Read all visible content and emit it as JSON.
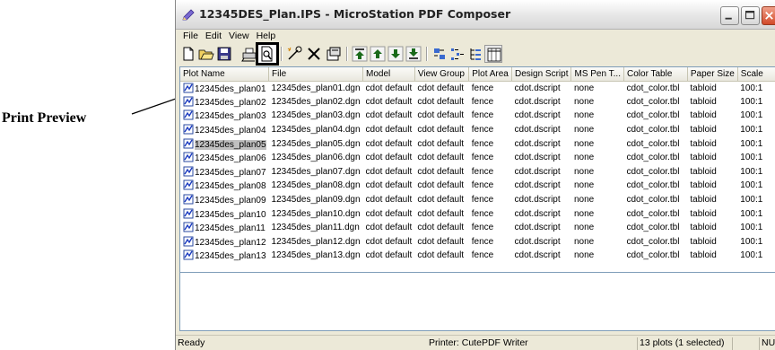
{
  "annotation": {
    "label": "Print Preview"
  },
  "window": {
    "title": "12345DES_Plan.IPS - MicroStation PDF Composer"
  },
  "menu": [
    "File",
    "Edit",
    "View",
    "Help"
  ],
  "toolbar": [
    {
      "icon": "new-document-icon"
    },
    {
      "icon": "open-folder-icon"
    },
    {
      "icon": "save-icon"
    },
    {
      "icon": "print-icon"
    },
    {
      "icon": "print-preview-icon"
    },
    {
      "icon": "add-plots-icon"
    },
    {
      "icon": "delete-icon"
    },
    {
      "icon": "properties-icon"
    },
    {
      "icon": "move-top-icon"
    },
    {
      "icon": "move-up-icon"
    },
    {
      "icon": "move-down-icon"
    },
    {
      "icon": "move-bottom-icon"
    },
    {
      "icon": "large-icons-view-icon"
    },
    {
      "icon": "list-view-icon"
    },
    {
      "icon": "tree-view-icon"
    },
    {
      "icon": "details-view-icon"
    }
  ],
  "table": {
    "columns": [
      "Plot Name",
      "File",
      "Model",
      "View Group",
      "Plot Area",
      "Design Script",
      "MS Pen T...",
      "Color Table",
      "Paper Size",
      "Scale"
    ],
    "rows": [
      [
        "12345des_plan01",
        "12345des_plan01.dgn",
        "cdot default",
        "cdot default",
        "fence",
        "cdot.dscript",
        "none",
        "cdot_color.tbl",
        "tabloid",
        "100:1"
      ],
      [
        "12345des_plan02",
        "12345des_plan02.dgn",
        "cdot default",
        "cdot default",
        "fence",
        "cdot.dscript",
        "none",
        "cdot_color.tbl",
        "tabloid",
        "100:1"
      ],
      [
        "12345des_plan03",
        "12345des_plan03.dgn",
        "cdot default",
        "cdot default",
        "fence",
        "cdot.dscript",
        "none",
        "cdot_color.tbl",
        "tabloid",
        "100:1"
      ],
      [
        "12345des_plan04",
        "12345des_plan04.dgn",
        "cdot default",
        "cdot default",
        "fence",
        "cdot.dscript",
        "none",
        "cdot_color.tbl",
        "tabloid",
        "100:1"
      ],
      [
        "12345des_plan05",
        "12345des_plan05.dgn",
        "cdot default",
        "cdot default",
        "fence",
        "cdot.dscript",
        "none",
        "cdot_color.tbl",
        "tabloid",
        "100:1"
      ],
      [
        "12345des_plan06",
        "12345des_plan06.dgn",
        "cdot default",
        "cdot default",
        "fence",
        "cdot.dscript",
        "none",
        "cdot_color.tbl",
        "tabloid",
        "100:1"
      ],
      [
        "12345des_plan07",
        "12345des_plan07.dgn",
        "cdot default",
        "cdot default",
        "fence",
        "cdot.dscript",
        "none",
        "cdot_color.tbl",
        "tabloid",
        "100:1"
      ],
      [
        "12345des_plan08",
        "12345des_plan08.dgn",
        "cdot default",
        "cdot default",
        "fence",
        "cdot.dscript",
        "none",
        "cdot_color.tbl",
        "tabloid",
        "100:1"
      ],
      [
        "12345des_plan09",
        "12345des_plan09.dgn",
        "cdot default",
        "cdot default",
        "fence",
        "cdot.dscript",
        "none",
        "cdot_color.tbl",
        "tabloid",
        "100:1"
      ],
      [
        "12345des_plan10",
        "12345des_plan10.dgn",
        "cdot default",
        "cdot default",
        "fence",
        "cdot.dscript",
        "none",
        "cdot_color.tbl",
        "tabloid",
        "100:1"
      ],
      [
        "12345des_plan11",
        "12345des_plan11.dgn",
        "cdot default",
        "cdot default",
        "fence",
        "cdot.dscript",
        "none",
        "cdot_color.tbl",
        "tabloid",
        "100:1"
      ],
      [
        "12345des_plan12",
        "12345des_plan12.dgn",
        "cdot default",
        "cdot default",
        "fence",
        "cdot.dscript",
        "none",
        "cdot_color.tbl",
        "tabloid",
        "100:1"
      ],
      [
        "12345des_plan13",
        "12345des_plan13.dgn",
        "cdot default",
        "cdot default",
        "fence",
        "cdot.dscript",
        "none",
        "cdot_color.tbl",
        "tabloid",
        "100:1"
      ]
    ],
    "selected_row": 4
  },
  "status": {
    "left": "Ready",
    "printer": "Printer: CutePDF Writer",
    "plots": "13 plots (1 selected)",
    "num": "NUM"
  },
  "colors": {
    "accent": "#0a246a",
    "selection": "#c0c0c0",
    "window_bg": "#ece9d8"
  }
}
